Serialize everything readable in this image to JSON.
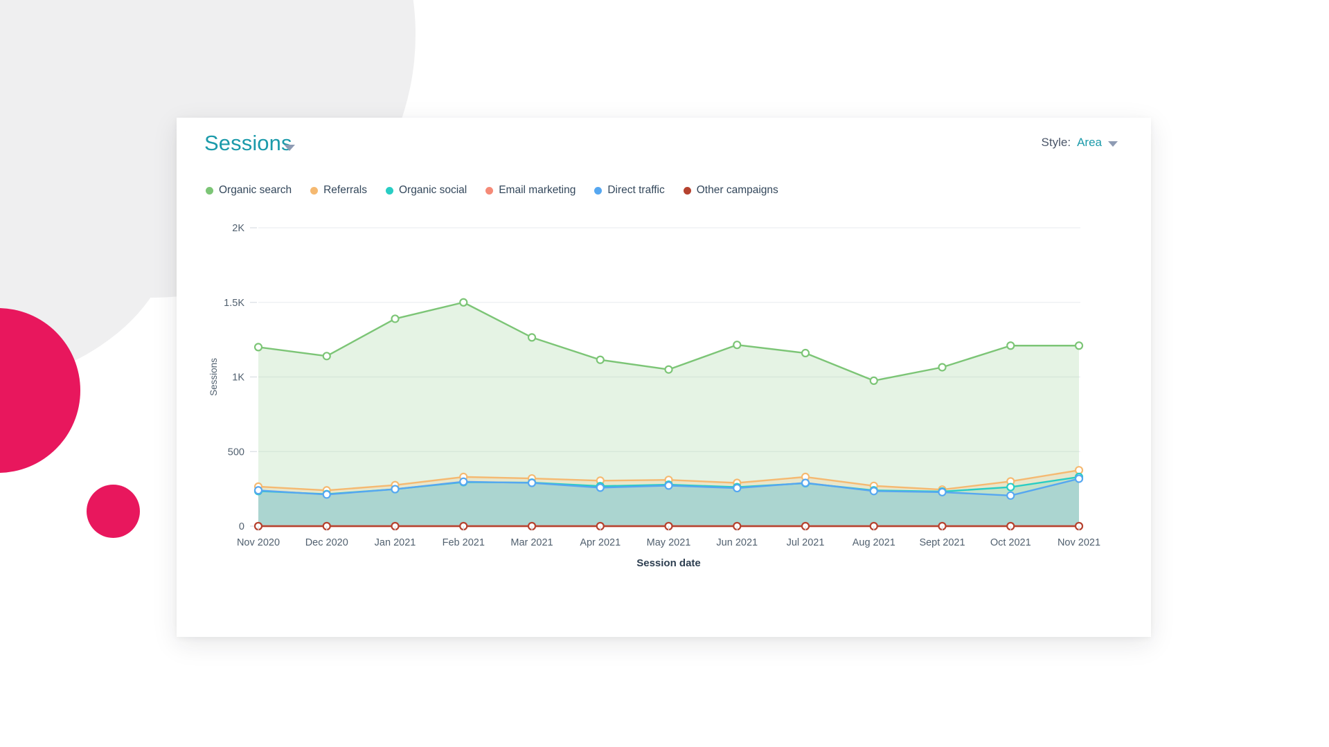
{
  "background": {
    "page_color": "#ffffff",
    "gray_circle_color": "#efeff0",
    "pink_circle_color": "#e8175d"
  },
  "card": {
    "background": "#ffffff"
  },
  "header": {
    "title": "Sessions",
    "title_color": "#1b9aaa",
    "title_caret_icon": "chevron-down-icon",
    "style_label": "Style:",
    "style_value": "Area",
    "style_caret_icon": "chevron-down-icon"
  },
  "legend": {
    "items": [
      {
        "label": "Organic search",
        "color": "#7cc576"
      },
      {
        "label": "Referrals",
        "color": "#f5b971"
      },
      {
        "label": "Organic social",
        "color": "#29cdc4"
      },
      {
        "label": "Email marketing",
        "color": "#f58a77"
      },
      {
        "label": "Direct traffic",
        "color": "#56a7f0"
      },
      {
        "label": "Other campaigns",
        "color": "#b5422f"
      }
    ]
  },
  "chart_data": {
    "type": "area",
    "title": "Sessions",
    "xlabel": "Session date",
    "ylabel": "Sessions",
    "grid": true,
    "legend_position": "top-left",
    "ylim": [
      0,
      2000
    ],
    "ytick_values": [
      0,
      500,
      1000,
      1500,
      2000
    ],
    "ytick_labels": [
      "0",
      "500",
      "1K",
      "1.5K",
      "2K"
    ],
    "categories": [
      "Nov 2020",
      "Dec 2020",
      "Jan 2021",
      "Feb 2021",
      "Mar 2021",
      "Apr 2021",
      "May 2021",
      "Jun 2021",
      "Jul 2021",
      "Aug 2021",
      "Sept 2021",
      "Oct 2021",
      "Nov 2021"
    ],
    "series": [
      {
        "name": "Organic search",
        "color": "#7cc576",
        "fill": "rgba(124,197,118,0.20)",
        "values": [
          1200,
          1140,
          1390,
          1500,
          1265,
          1115,
          1050,
          1215,
          1160,
          975,
          1065,
          1210,
          1210
        ]
      },
      {
        "name": "Referrals",
        "color": "#f5b971",
        "fill": "rgba(245,185,113,0.22)",
        "values": [
          265,
          240,
          275,
          330,
          320,
          305,
          310,
          290,
          330,
          270,
          245,
          300,
          375
        ]
      },
      {
        "name": "Organic social",
        "color": "#29cdc4",
        "fill": "rgba(41,205,196,0.20)",
        "values": [
          235,
          215,
          248,
          295,
          292,
          268,
          278,
          262,
          288,
          240,
          232,
          262,
          330
        ]
      },
      {
        "name": "Email marketing",
        "color": "#f58a77",
        "fill": "rgba(245,138,119,0.18)",
        "values": [
          0,
          0,
          0,
          0,
          0,
          0,
          0,
          0,
          0,
          0,
          0,
          0,
          0
        ]
      },
      {
        "name": "Direct traffic",
        "color": "#56a7f0",
        "fill": "rgba(86,167,240,0.20)",
        "values": [
          240,
          212,
          248,
          298,
          290,
          258,
          272,
          255,
          290,
          235,
          228,
          205,
          318
        ]
      },
      {
        "name": "Other campaigns",
        "color": "#b5422f",
        "fill": "rgba(181,66,47,0.14)",
        "values": [
          0,
          0,
          0,
          0,
          0,
          0,
          0,
          0,
          0,
          0,
          0,
          0,
          0
        ]
      }
    ]
  }
}
